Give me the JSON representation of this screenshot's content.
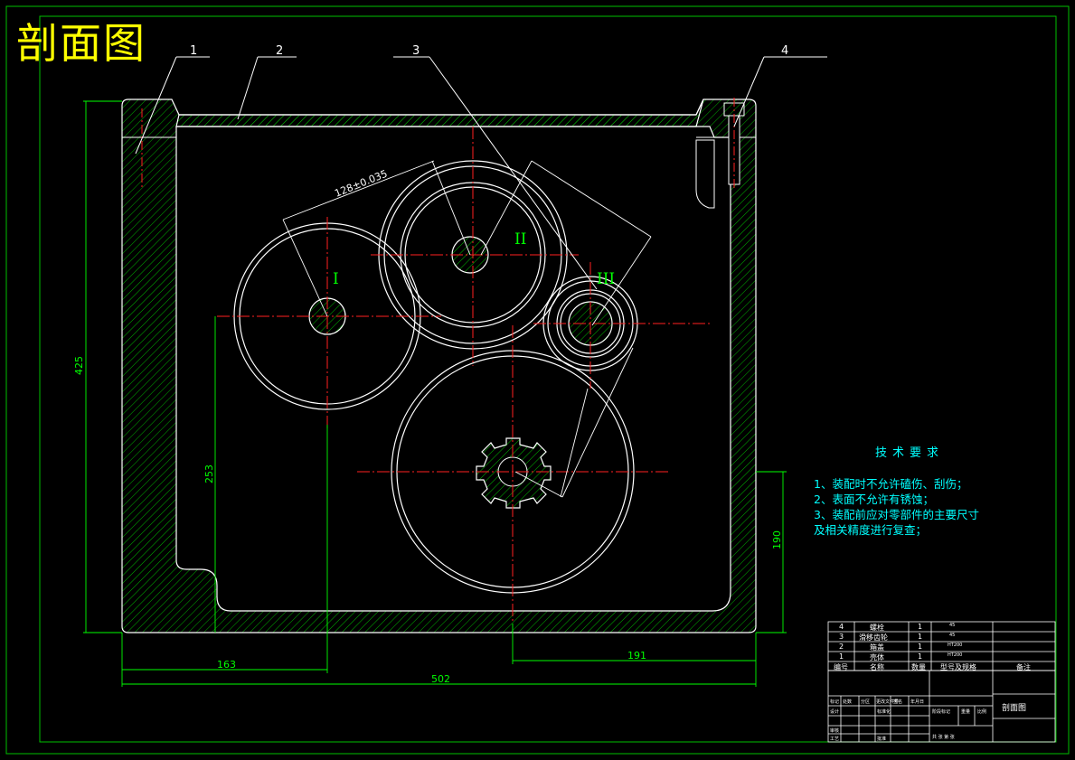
{
  "drawing_title": "剖面图",
  "part_callouts": [
    "1",
    "2",
    "3",
    "4"
  ],
  "shaft_labels": [
    "I",
    "II",
    "III"
  ],
  "dimensions": {
    "center_distance": "128±0.035",
    "height": "425",
    "shaft_height": "253",
    "right_height": "190",
    "left_offset": "163",
    "right_offset": "191",
    "overall_width": "502"
  },
  "technical_requirements": {
    "title": "技术要求",
    "items": [
      "1、装配时不允许磕伤、刮伤；",
      "2、表面不允许有锈蚀；",
      "3、装配前应对零部件的主要尺寸",
      "及相关精度进行复查；"
    ]
  },
  "bom": {
    "rows": [
      {
        "no": "4",
        "name": "螺栓",
        "qty": "1",
        "material": "45"
      },
      {
        "no": "3",
        "name": "滑移齿轮",
        "qty": "1",
        "material": "45"
      },
      {
        "no": "2",
        "name": "箱盖",
        "qty": "1",
        "material": "HT200"
      },
      {
        "no": "1",
        "name": "壳体",
        "qty": "1",
        "material": "HT200"
      }
    ],
    "header": {
      "no": "编号",
      "name": "名称",
      "qty": "数量",
      "material": "型号及规格",
      "note": "备注"
    }
  },
  "title_block": {
    "drawing_name": "剖面图",
    "small_labels": [
      "标记",
      "处数",
      "分区",
      "更改文件号",
      "签名",
      "年月日",
      "设计",
      "标准化",
      "阶段标记",
      "重量",
      "比例",
      "审核",
      "工艺",
      "批准",
      "共 张 第 张"
    ]
  },
  "colors": {
    "background": "#000000",
    "outline": "#ffffff",
    "hatch": "#00c000",
    "dimension": "#00ff00",
    "centerline": "#ff0000",
    "title": "#ffff00",
    "text": "#00ffff"
  }
}
